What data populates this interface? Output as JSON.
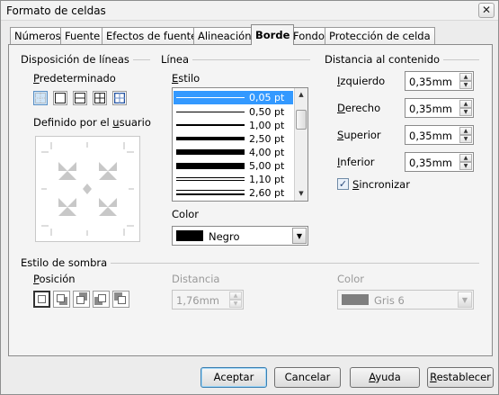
{
  "window": {
    "title": "Formato de celdas",
    "close_glyph": "✕"
  },
  "tabs": [
    {
      "label": "Números"
    },
    {
      "label": "Fuente"
    },
    {
      "label": "Efectos de fuente"
    },
    {
      "label": "Alineación"
    },
    {
      "label": "Borde",
      "active": true
    },
    {
      "label": "Fondo"
    },
    {
      "label": "Protección de celda"
    }
  ],
  "line_arrangement": {
    "heading": "Disposición de líneas",
    "default_label_u": "P",
    "default_label_rest": "redeterminado",
    "user_defined_before": "Definido por el ",
    "user_defined_u": "u",
    "user_defined_after": "suario",
    "presets": [
      "none-borders",
      "outer-border",
      "outer-and-horizontal",
      "outer-and-all-inner",
      "outer-only-keep-inner"
    ]
  },
  "line": {
    "heading": "Línea",
    "style_label_u": "E",
    "style_label_rest": "stilo",
    "styles": [
      {
        "label": "0,05 pt",
        "selected": true
      },
      {
        "label": "0,50 pt"
      },
      {
        "label": "1,00 pt"
      },
      {
        "label": "2,50 pt"
      },
      {
        "label": "4,00 pt"
      },
      {
        "label": "5,00 pt"
      },
      {
        "label": "1,10 pt"
      },
      {
        "label": "2,60 pt"
      }
    ],
    "color_label": "Color",
    "color_value": "Negro",
    "color_hex": "#000000"
  },
  "spacing": {
    "heading": "Distancia al contenido",
    "fields": [
      {
        "label_u": "I",
        "label_rest": "zquierdo",
        "value": "0,35mm"
      },
      {
        "label_u": "D",
        "label_rest": "erecho",
        "value": "0,35mm"
      },
      {
        "label_u": "S",
        "label_rest": "uperior",
        "value": "0,35mm"
      },
      {
        "label_u": "I",
        "label_rest": "nferior",
        "value": "0,35mm"
      }
    ],
    "sync_label_u": "S",
    "sync_label_rest": "incronizar",
    "sync_checked": true,
    "check_glyph": "✓"
  },
  "shadow": {
    "heading": "Estilo de sombra",
    "position_label_u": "P",
    "position_label_rest": "osición",
    "distance_label": "Distancia",
    "distance_value": "1,76mm",
    "color_label": "Color",
    "color_value": "Gris 6",
    "color_hex": "#7f7f7f"
  },
  "buttons": {
    "ok": "Aceptar",
    "cancel": "Cancelar",
    "help_u": "A",
    "help_rest": "yuda",
    "reset_u": "R",
    "reset_rest": "establecer"
  }
}
